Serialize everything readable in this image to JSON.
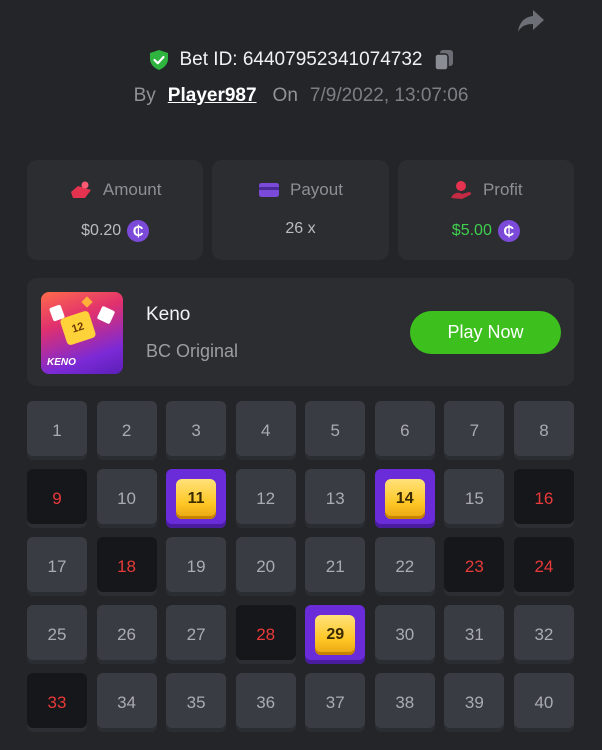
{
  "header": {
    "bet_label": "Bet ID:",
    "bet_id": "64407952341074732",
    "by_label": "By",
    "player": "Player987",
    "on_label": "On",
    "date": "7/9/2022, 13:07:06"
  },
  "stats": {
    "amount": {
      "label": "Amount",
      "value": "$0.20"
    },
    "payout": {
      "label": "Payout",
      "value": "26 x"
    },
    "profit": {
      "label": "Profit",
      "value": "$5.00"
    }
  },
  "game": {
    "thumb_label": "KENO",
    "thumb_number": "12",
    "title": "Keno",
    "subtitle": "BC Original",
    "play_label": "Play Now"
  },
  "colors": {
    "hit": "#6a2bd8",
    "miss_text": "#e83a3a",
    "play_button": "#3dbf1e",
    "profit": "#3fcf4e",
    "coin": "#7b4ad9"
  },
  "board": {
    "cells": [
      {
        "n": "1",
        "state": "normal"
      },
      {
        "n": "2",
        "state": "normal"
      },
      {
        "n": "3",
        "state": "normal"
      },
      {
        "n": "4",
        "state": "normal"
      },
      {
        "n": "5",
        "state": "normal"
      },
      {
        "n": "6",
        "state": "normal"
      },
      {
        "n": "7",
        "state": "normal"
      },
      {
        "n": "8",
        "state": "normal"
      },
      {
        "n": "9",
        "state": "miss"
      },
      {
        "n": "10",
        "state": "normal"
      },
      {
        "n": "11",
        "state": "hit"
      },
      {
        "n": "12",
        "state": "normal"
      },
      {
        "n": "13",
        "state": "normal"
      },
      {
        "n": "14",
        "state": "hit"
      },
      {
        "n": "15",
        "state": "normal"
      },
      {
        "n": "16",
        "state": "miss"
      },
      {
        "n": "17",
        "state": "normal"
      },
      {
        "n": "18",
        "state": "miss"
      },
      {
        "n": "19",
        "state": "normal"
      },
      {
        "n": "20",
        "state": "normal"
      },
      {
        "n": "21",
        "state": "normal"
      },
      {
        "n": "22",
        "state": "normal"
      },
      {
        "n": "23",
        "state": "miss"
      },
      {
        "n": "24",
        "state": "miss"
      },
      {
        "n": "25",
        "state": "normal"
      },
      {
        "n": "26",
        "state": "normal"
      },
      {
        "n": "27",
        "state": "normal"
      },
      {
        "n": "28",
        "state": "miss"
      },
      {
        "n": "29",
        "state": "hit"
      },
      {
        "n": "30",
        "state": "normal"
      },
      {
        "n": "31",
        "state": "normal"
      },
      {
        "n": "32",
        "state": "normal"
      },
      {
        "n": "33",
        "state": "miss"
      },
      {
        "n": "34",
        "state": "normal"
      },
      {
        "n": "35",
        "state": "normal"
      },
      {
        "n": "36",
        "state": "normal"
      },
      {
        "n": "37",
        "state": "normal"
      },
      {
        "n": "38",
        "state": "normal"
      },
      {
        "n": "39",
        "state": "normal"
      },
      {
        "n": "40",
        "state": "normal"
      }
    ]
  }
}
